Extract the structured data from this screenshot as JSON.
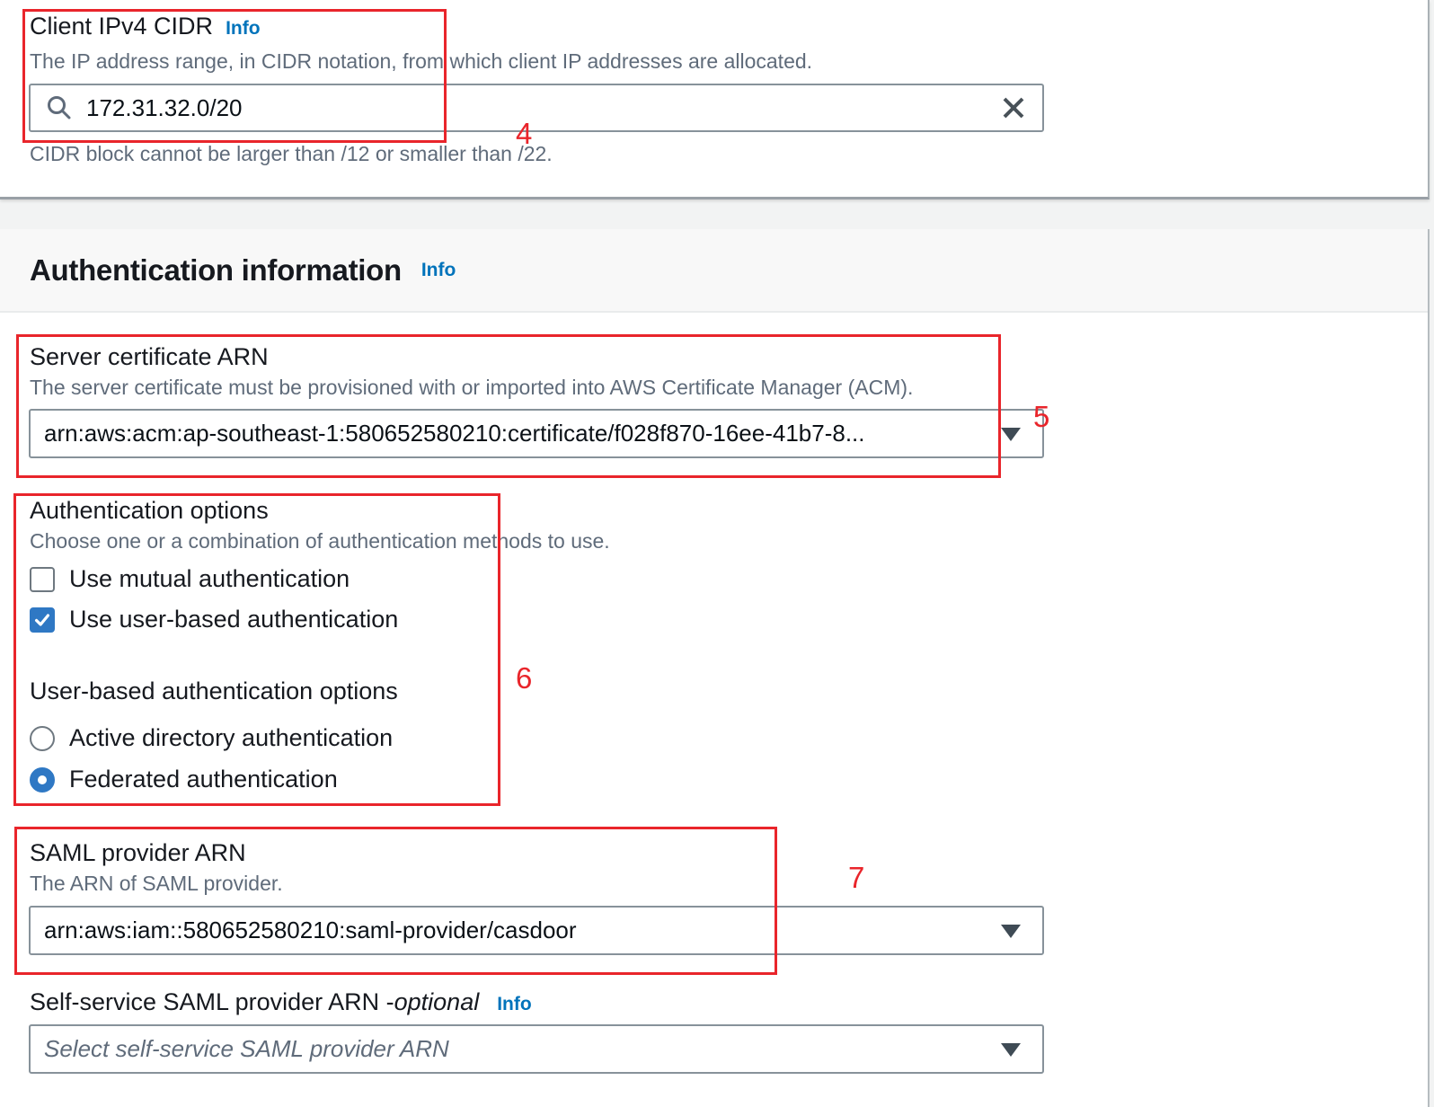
{
  "colors": {
    "info_link": "#0073bb",
    "annotation_red": "#e9252b",
    "control_blue": "#2f78c4",
    "label_text": "#16191f",
    "secondary_text": "#5f6b7a"
  },
  "client_cidr": {
    "label": "Client IPv4 CIDR",
    "info_label": "Info",
    "description": "The IP address range, in CIDR notation, from which client IP addresses are allocated.",
    "value": "172.31.32.0/20",
    "constraint": "CIDR block cannot be larger than /12 or smaller than /22."
  },
  "auth_section": {
    "title": "Authentication information",
    "info_label": "Info",
    "server_certificate": {
      "label": "Server certificate ARN",
      "description": "The server certificate must be provisioned with or imported into AWS Certificate Manager (ACM).",
      "value": "arn:aws:acm:ap-southeast-1:580652580210:certificate/f028f870-16ee-41b7-8..."
    },
    "auth_options": {
      "label": "Authentication options",
      "description": "Choose one or a combination of authentication methods to use.",
      "checkboxes": [
        {
          "label": "Use mutual authentication",
          "checked": false
        },
        {
          "label": "Use user-based authentication",
          "checked": true
        }
      ]
    },
    "user_based_options": {
      "label": "User-based authentication options",
      "radios": [
        {
          "label": "Active directory authentication",
          "selected": false
        },
        {
          "label": "Federated authentication",
          "selected": true
        }
      ]
    },
    "saml_provider": {
      "label": "SAML provider ARN",
      "description": "The ARN of SAML provider.",
      "value": "arn:aws:iam::580652580210:saml-provider/casdoor"
    },
    "self_service_saml": {
      "label_prefix": "Self-service SAML provider ARN - ",
      "optional_label": "optional",
      "info_label": "Info",
      "placeholder": "Select self-service SAML provider ARN"
    }
  },
  "annotations": [
    {
      "number": "4"
    },
    {
      "number": "5"
    },
    {
      "number": "6"
    },
    {
      "number": "7"
    }
  ]
}
